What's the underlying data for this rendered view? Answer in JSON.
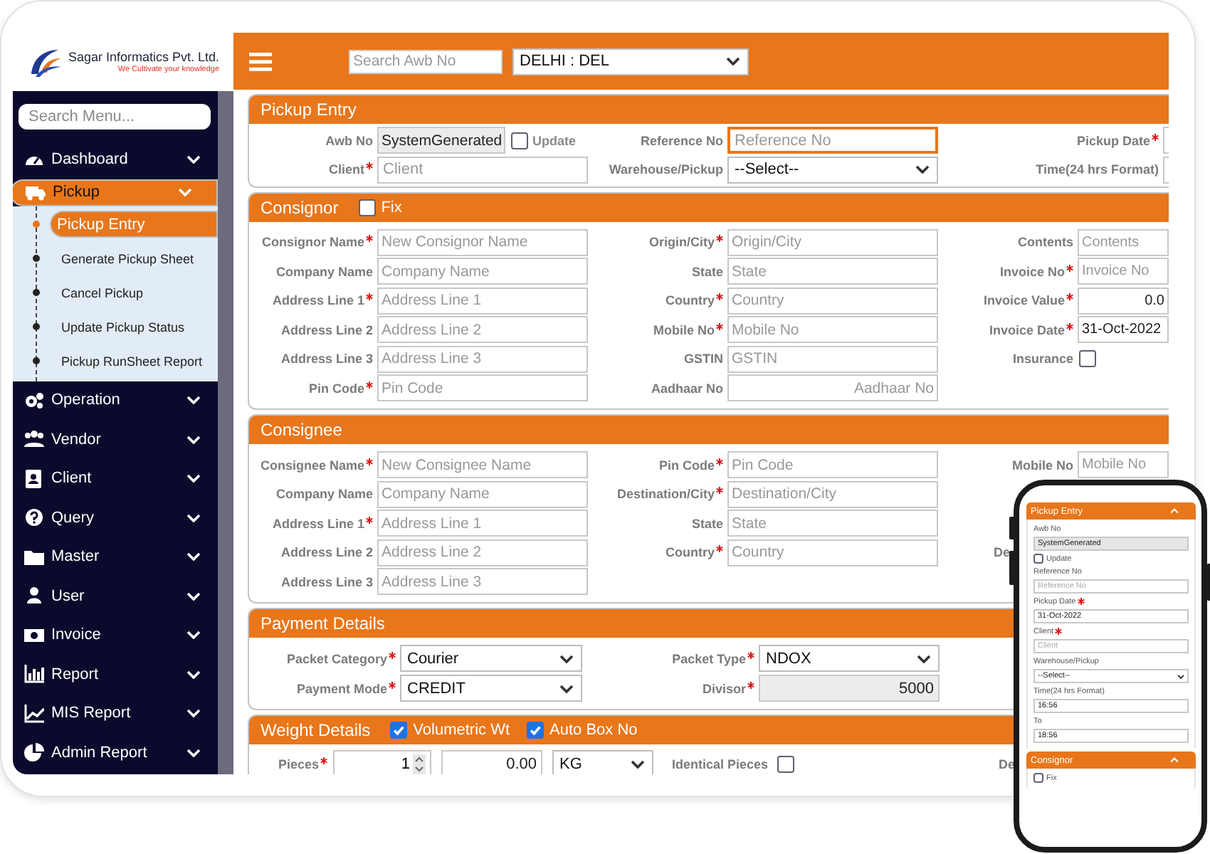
{
  "brand": {
    "name": "Sagar Informatics Pvt. Ltd.",
    "tagline": "We Cultivate your knowledge"
  },
  "sidebar": {
    "search": {
      "placeholder": "Search Menu..."
    },
    "items": [
      {
        "label": "Dashboard",
        "selected": false
      },
      {
        "label": "Pickup",
        "selected": true,
        "children": [
          {
            "label": "Pickup Entry",
            "selected": true
          },
          {
            "label": "Generate Pickup Sheet",
            "selected": false
          },
          {
            "label": "Cancel Pickup",
            "selected": false
          },
          {
            "label": "Update Pickup Status",
            "selected": false
          },
          {
            "label": "Pickup RunSheet Report",
            "selected": false
          }
        ]
      },
      {
        "label": "Operation",
        "selected": false
      },
      {
        "label": "Vendor",
        "selected": false
      },
      {
        "label": "Client",
        "selected": false
      },
      {
        "label": "Query",
        "selected": false
      },
      {
        "label": "Master",
        "selected": false
      },
      {
        "label": "User",
        "selected": false
      },
      {
        "label": "Invoice",
        "selected": false
      },
      {
        "label": "Report",
        "selected": false
      },
      {
        "label": "MIS Report",
        "selected": false
      },
      {
        "label": "Admin Report",
        "selected": false
      }
    ]
  },
  "topbar": {
    "search": {
      "placeholder": "Search Awb No"
    },
    "branch": {
      "value": "DELHI : DEL"
    }
  },
  "sections": [
    {
      "kind": "header",
      "title": "Pickup Entry",
      "rows": [
        [
          {
            "label": "Awb No",
            "required": false,
            "kind": "readonly",
            "value": "SystemGenerated",
            "focused": false,
            "option": {
              "label": "Update",
              "checked": false
            }
          },
          {
            "label": "Reference No",
            "required": false,
            "kind": "text",
            "placeholder": "Reference No",
            "focused": true
          },
          {
            "label": "Pickup Date",
            "required": true,
            "kind": "text",
            "focused": false
          }
        ],
        [
          {
            "label": "Client",
            "required": true,
            "kind": "text",
            "placeholder": "Client",
            "focused": false
          },
          {
            "label": "Warehouse/Pickup",
            "required": false,
            "kind": "select",
            "value": "--Select--",
            "focused": false
          },
          {
            "label": "Time(24 hrs Format)",
            "required": false,
            "kind": "text",
            "focused": false
          }
        ]
      ]
    },
    {
      "kind": "grid",
      "title": "Consignor",
      "options": [
        {
          "label": "Fix",
          "checked": false
        }
      ],
      "rows": [
        [
          {
            "label": "Consignor Name",
            "required": true,
            "kind": "text",
            "placeholder": "New Consignor Name"
          },
          {
            "label": "Origin/City",
            "required": true,
            "kind": "text",
            "placeholder": "Origin/City"
          },
          {
            "label": "Contents",
            "required": false,
            "kind": "text",
            "placeholder": "Contents"
          }
        ],
        [
          {
            "label": "Company Name",
            "required": false,
            "kind": "text",
            "placeholder": "Company Name"
          },
          {
            "label": "State",
            "required": false,
            "kind": "text",
            "placeholder": "State"
          },
          {
            "label": "Invoice No",
            "required": true,
            "kind": "text",
            "placeholder": "Invoice No"
          }
        ],
        [
          {
            "label": "Address Line 1",
            "required": true,
            "kind": "text",
            "placeholder": "Address Line 1"
          },
          {
            "label": "Country",
            "required": true,
            "kind": "text",
            "placeholder": "Country"
          },
          {
            "label": "Invoice Value",
            "required": true,
            "kind": "number",
            "value": "0.0"
          }
        ],
        [
          {
            "label": "Address Line 2",
            "required": false,
            "kind": "text",
            "placeholder": "Address Line 2"
          },
          {
            "label": "Mobile No",
            "required": true,
            "kind": "text",
            "placeholder": "Mobile No"
          },
          {
            "label": "Invoice Date",
            "required": true,
            "kind": "text",
            "value": "31-Oct-2022"
          }
        ],
        [
          {
            "label": "Address Line 3",
            "required": false,
            "kind": "text",
            "placeholder": "Address Line 3"
          },
          {
            "label": "GSTIN",
            "required": false,
            "kind": "text",
            "placeholder": "GSTIN"
          },
          {
            "label": "Insurance",
            "required": false,
            "kind": "checkbox",
            "checked": false
          }
        ],
        [
          {
            "label": "Pin Code",
            "required": true,
            "kind": "text",
            "placeholder": "Pin Code"
          },
          {
            "label": "Aadhaar No",
            "required": false,
            "kind": "number",
            "placeholder": "Aadhaar No"
          }
        ]
      ]
    },
    {
      "kind": "grid",
      "title": "Consignee",
      "rows": [
        [
          {
            "label": "Consignee Name",
            "required": true,
            "kind": "text",
            "placeholder": "New Consignee Name"
          },
          {
            "label": "Pin Code",
            "required": true,
            "kind": "text",
            "placeholder": "Pin Code"
          },
          {
            "label": "Mobile No",
            "required": false,
            "kind": "text",
            "placeholder": "Mobile No"
          }
        ],
        [
          {
            "label": "Company Name",
            "required": false,
            "kind": "text",
            "placeholder": "Company Name"
          },
          {
            "label": "Destination/City",
            "required": true,
            "kind": "text",
            "placeholder": "Destination/City"
          }
        ],
        [
          {
            "label": "Address Line 1",
            "required": true,
            "kind": "text",
            "placeholder": "Address Line 1"
          },
          {
            "label": "State",
            "required": false,
            "kind": "text",
            "placeholder": "State"
          }
        ],
        [
          {
            "label": "Address Line 2",
            "required": false,
            "kind": "text",
            "placeholder": "Address Line 2"
          },
          {
            "label": "Country",
            "required": true,
            "kind": "text",
            "placeholder": "Country"
          },
          {
            "label": "De",
            "required": false,
            "kind": "label"
          }
        ],
        [
          {
            "label": "Address Line 3",
            "required": false,
            "kind": "text",
            "placeholder": "Address Line 3"
          }
        ]
      ]
    },
    {
      "kind": "payment",
      "title": "Payment Details",
      "rows": [
        [
          {
            "label": "Packet Category",
            "required": true,
            "kind": "select",
            "value": "Courier"
          },
          {
            "label": "Packet Type",
            "required": true,
            "kind": "select",
            "value": "NDOX"
          }
        ],
        [
          {
            "label": "Payment Mode",
            "required": true,
            "kind": "select",
            "value": "CREDIT"
          },
          {
            "label": "Divisor",
            "required": true,
            "kind": "fixed",
            "value": "5000"
          }
        ]
      ]
    },
    {
      "kind": "weight",
      "title": "Weight Details",
      "options": [
        {
          "label": "Volumetric Wt",
          "checked": true
        },
        {
          "label": "Auto Box No",
          "checked": true
        }
      ],
      "items": [
        {
          "label": "Pieces",
          "required": true,
          "kind": "spinner",
          "value": "1"
        },
        {
          "kind": "number",
          "value": "0.00"
        },
        {
          "kind": "select",
          "value": "KG"
        },
        {
          "label": "Identical Pieces",
          "required": false,
          "kind": "checkbox",
          "checked": false
        },
        {
          "label": "De",
          "required": false,
          "kind": "label"
        }
      ]
    }
  ],
  "mobile_preview": {
    "sections": [
      {
        "title": "Pickup Entry",
        "expanded": true,
        "fields": [
          {
            "label": "Awb No",
            "required": false,
            "kind": "readonly",
            "value": "SystemGenerated"
          },
          {
            "label": "Update",
            "kind": "checkbox",
            "checked": false
          },
          {
            "label": "Reference No",
            "required": false,
            "kind": "text",
            "placeholder": "Reference No"
          },
          {
            "label": "Pickup Date",
            "required": true,
            "kind": "text",
            "value": "31-Oct-2022"
          },
          {
            "label": "Client",
            "required": true,
            "kind": "text",
            "placeholder": "Client"
          },
          {
            "label": "Warehouse/Pickup",
            "required": false,
            "kind": "select",
            "value": "--Select--"
          },
          {
            "label": "Time(24 hrs Format)",
            "required": false,
            "kind": "text",
            "value": "16:56"
          },
          {
            "label": "To",
            "required": false,
            "kind": "text",
            "value": "18:56"
          }
        ]
      },
      {
        "title": "Consignor",
        "expanded": true,
        "fields": [
          {
            "label": "Fix",
            "kind": "checkbox",
            "checked": false
          }
        ]
      }
    ]
  }
}
